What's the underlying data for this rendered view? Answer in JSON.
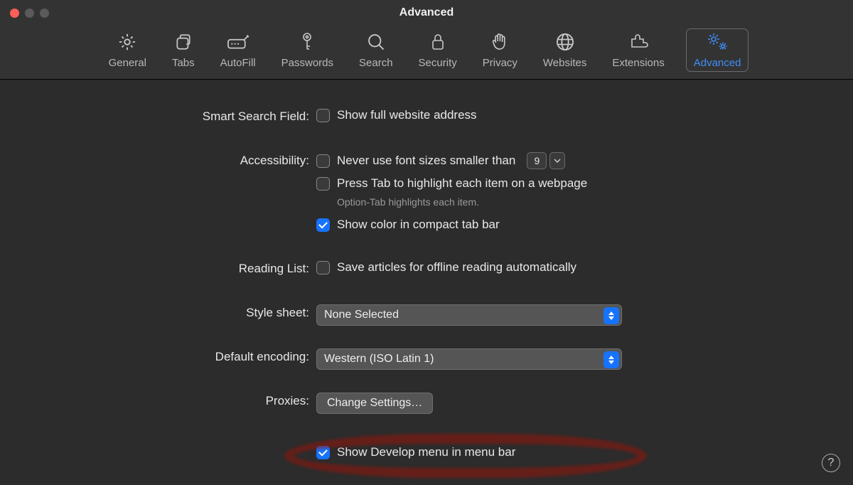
{
  "window": {
    "title": "Advanced"
  },
  "toolbar": {
    "items": [
      {
        "id": "general",
        "label": "General"
      },
      {
        "id": "tabs",
        "label": "Tabs"
      },
      {
        "id": "autofill",
        "label": "AutoFill"
      },
      {
        "id": "passwords",
        "label": "Passwords"
      },
      {
        "id": "search",
        "label": "Search"
      },
      {
        "id": "security",
        "label": "Security"
      },
      {
        "id": "privacy",
        "label": "Privacy"
      },
      {
        "id": "websites",
        "label": "Websites"
      },
      {
        "id": "extensions",
        "label": "Extensions"
      },
      {
        "id": "advanced",
        "label": "Advanced",
        "active": true
      }
    ]
  },
  "sections": {
    "smart_search": {
      "label": "Smart Search Field:",
      "show_full_url": {
        "checked": false,
        "label": "Show full website address"
      }
    },
    "accessibility": {
      "label": "Accessibility:",
      "min_font": {
        "checked": false,
        "label": "Never use font sizes smaller than",
        "value": "9"
      },
      "press_tab": {
        "checked": false,
        "label": "Press Tab to highlight each item on a webpage"
      },
      "hint": "Option-Tab highlights each item.",
      "compact_color": {
        "checked": true,
        "label": "Show color in compact tab bar"
      }
    },
    "reading_list": {
      "label": "Reading List:",
      "offline": {
        "checked": false,
        "label": "Save articles for offline reading automatically"
      }
    },
    "style_sheet": {
      "label": "Style sheet:",
      "value": "None Selected"
    },
    "default_encoding": {
      "label": "Default encoding:",
      "value": "Western (ISO Latin 1)"
    },
    "proxies": {
      "label": "Proxies:",
      "button": "Change Settings…"
    },
    "develop": {
      "checked": true,
      "label": "Show Develop menu in menu bar"
    }
  },
  "help_tooltip": "?"
}
